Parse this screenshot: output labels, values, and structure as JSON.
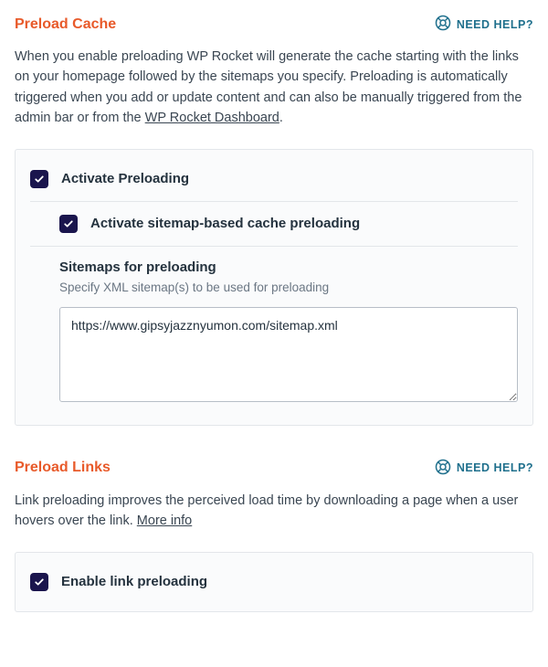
{
  "colors": {
    "accent": "#e85a2a",
    "brand": "#1a154d",
    "link": "#1e6f8c"
  },
  "helpLabel": "NEED HELP?",
  "preloadCache": {
    "title": "Preload Cache",
    "desc_before": "When you enable preloading WP Rocket will generate the cache starting with the links on your homepage followed by the sitemaps you specify. Preloading is automatically triggered when you add or update content and can also be manually triggered from the admin bar or from the ",
    "desc_link": "WP Rocket Dashboard",
    "desc_after": ".",
    "activate_label": "Activate Preloading",
    "activate_checked": true,
    "sitemap_activate_label": "Activate sitemap-based cache preloading",
    "sitemap_activate_checked": true,
    "sitemaps_title": "Sitemaps for preloading",
    "sitemaps_hint": "Specify XML sitemap(s) to be used for preloading",
    "sitemaps_value": "https://www.gipsyjazznyumon.com/sitemap.xml"
  },
  "preloadLinks": {
    "title": "Preload Links",
    "desc_before": "Link preloading improves the perceived load time by downloading a page when a user hovers over the link. ",
    "desc_link": "More info",
    "desc_after": "",
    "enable_label": "Enable link preloading",
    "enable_checked": true
  }
}
